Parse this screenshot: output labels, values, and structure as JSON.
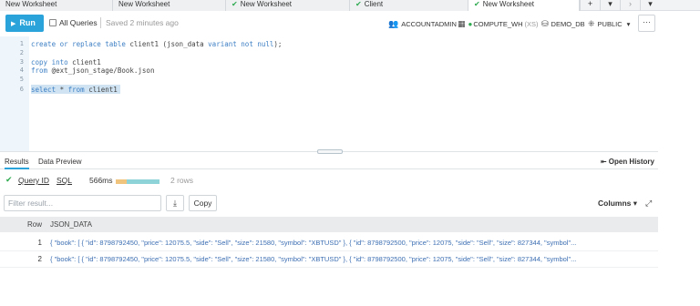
{
  "tabs": [
    {
      "label": "New Worksheet",
      "checked": false
    },
    {
      "label": "New Worksheet",
      "checked": false
    },
    {
      "label": "New Worksheet",
      "checked": true
    },
    {
      "label": "Client",
      "checked": true
    },
    {
      "label": "New Worksheet",
      "checked": true,
      "active": true
    }
  ],
  "tab_controls": {
    "add": "+",
    "menu": "▾",
    "next": "›",
    "dropdown": "▾"
  },
  "toolbar": {
    "run_label": "Run",
    "all_queries_label": "All Queries",
    "saved_text": "Saved 2 minutes ago",
    "role": "ACCOUNTADMIN",
    "warehouse": "COMPUTE_WH",
    "warehouse_size": "(XS)",
    "database": "DEMO_DB",
    "schema": "PUBLIC",
    "schema_caret": "▾",
    "more": "···"
  },
  "editor": {
    "line_numbers": [
      "1",
      "2",
      "3",
      "4",
      "5",
      "6"
    ],
    "lines": [
      "create or replace table client1 (json_data variant not null);",
      "",
      "copy into client1",
      "from @ext_json_stage/Book.json",
      "",
      "select * from client1"
    ]
  },
  "results": {
    "tab_results": "Results",
    "tab_preview": "Data Preview",
    "open_history": "Open History",
    "query_id": "Query ID",
    "sql": "SQL",
    "duration": "566ms",
    "duration_split": [
      0.25,
      0.75
    ],
    "row_count": "2 rows",
    "filter_placeholder": "Filter result...",
    "copy_label": "Copy",
    "columns_label": "Columns ▾",
    "headers": [
      "Row",
      "JSON_DATA"
    ],
    "rows": [
      {
        "row": "1",
        "json": "{ \"book\": [ { \"id\": 8798792450, \"price\": 12075.5, \"side\": \"Sell\", \"size\": 21580, \"symbol\": \"XBTUSD\" }, { \"id\": 8798792500, \"price\": 12075, \"side\": \"Sell\", \"size\": 827344, \"symbol\"..."
      },
      {
        "row": "2",
        "json": "{ \"book\": [ { \"id\": 8798792450, \"price\": 12075.5, \"side\": \"Sell\", \"size\": 21580, \"symbol\": \"XBTUSD\" }, { \"id\": 8798792500, \"price\": 12075, \"side\": \"Sell\", \"size\": 827344, \"symbol\"..."
      }
    ]
  },
  "colors": {
    "accent": "#29a3da",
    "success": "#2eaa4f",
    "link": "#3d6fb3"
  }
}
